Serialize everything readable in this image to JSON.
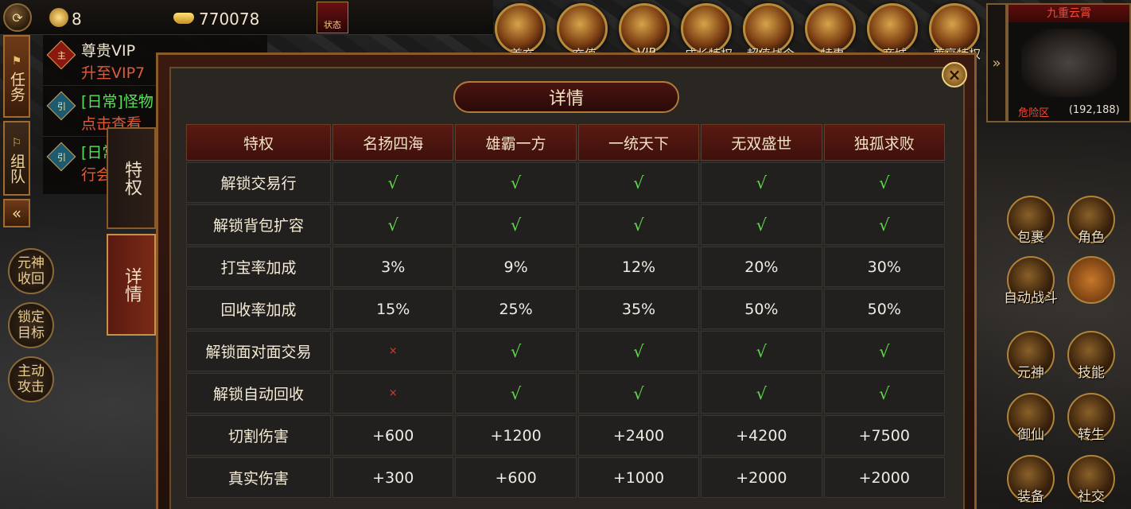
{
  "topbar": {
    "gold_count": "8",
    "ingot_count": "770078",
    "status_label": "状态",
    "top_icons": [
      "首充",
      "充值",
      "VIP",
      "成长特权",
      "超值战令",
      "特惠",
      "商城",
      "尊享特权"
    ]
  },
  "quest_panel": {
    "items": [
      {
        "badge": "主",
        "title": "尊贵VIP",
        "subtitle": "升至VIP7"
      },
      {
        "badge": "引",
        "title": "[日常]怪物",
        "subtitle": "点击查看"
      },
      {
        "badge": "引",
        "title": "[日常",
        "subtitle": "行会"
      }
    ],
    "tab_task": "任务",
    "tab_team": "组队"
  },
  "left_buttons": {
    "soul_recall": "元神收回",
    "lock_target": "锁定目标",
    "auto_attack": "主动攻击"
  },
  "minimap": {
    "map_name": "九重云霄",
    "zone": "危险区",
    "coords": "(192,188)"
  },
  "right_buttons": [
    "包裹",
    "角色",
    "自动战斗",
    "元神",
    "技能",
    "御仙",
    "转生",
    "装备",
    "社交"
  ],
  "dialog": {
    "title": "详情",
    "tab_privilege": "特权",
    "tab_details": "详情",
    "close_icon": "close-icon",
    "table": {
      "headers": [
        "特权",
        "名扬四海",
        "雄霸一方",
        "一统天下",
        "无双盛世",
        "独孤求败"
      ],
      "rows": [
        {
          "feature": "解锁交易行",
          "values": [
            "√",
            "√",
            "√",
            "√",
            "√"
          ]
        },
        {
          "feature": "解锁背包扩容",
          "values": [
            "√",
            "√",
            "√",
            "√",
            "√"
          ]
        },
        {
          "feature": "打宝率加成",
          "values": [
            "3%",
            "9%",
            "12%",
            "20%",
            "30%"
          ]
        },
        {
          "feature": "回收率加成",
          "values": [
            "15%",
            "25%",
            "35%",
            "50%",
            "50%"
          ]
        },
        {
          "feature": "解锁面对面交易",
          "values": [
            "×",
            "√",
            "√",
            "√",
            "√"
          ]
        },
        {
          "feature": "解锁自动回收",
          "values": [
            "×",
            "√",
            "√",
            "√",
            "√"
          ]
        },
        {
          "feature": "切割伤害",
          "values": [
            "+600",
            "+1200",
            "+2400",
            "+4200",
            "+7500"
          ]
        },
        {
          "feature": "真实伤害",
          "values": [
            "+300",
            "+600",
            "+1000",
            "+2000",
            "+2000"
          ]
        }
      ]
    }
  },
  "colors": {
    "check": "#5cd84a",
    "cross": "#d83a2a",
    "header_bg": "#5a1a12",
    "accent_gold": "#b07a3a"
  }
}
